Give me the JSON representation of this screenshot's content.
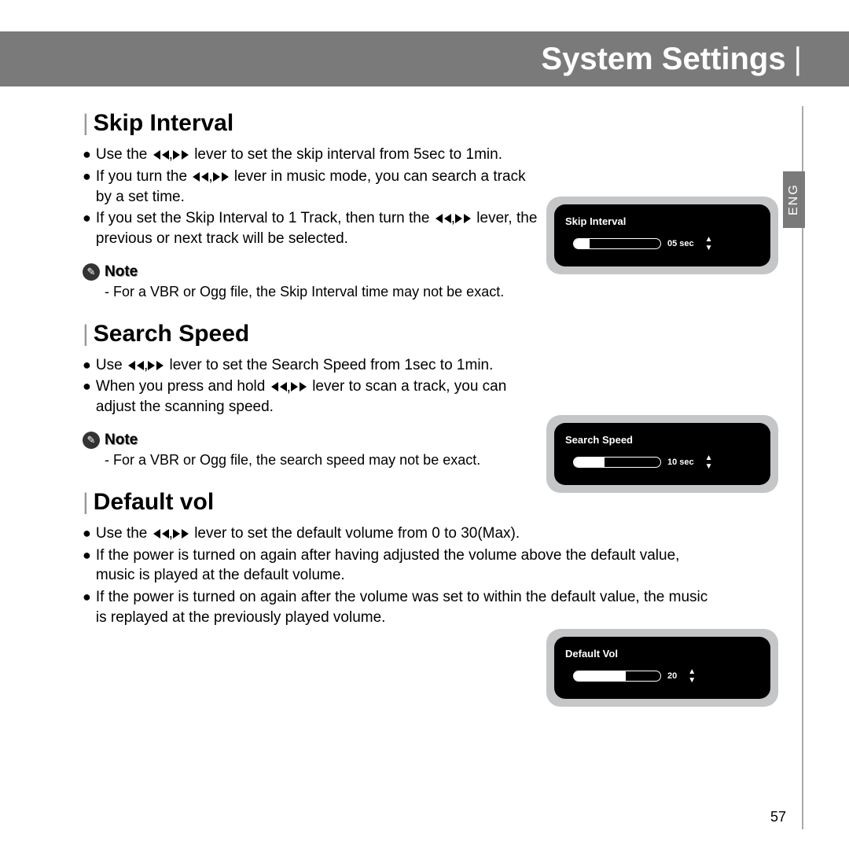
{
  "header": {
    "title": "System Settings"
  },
  "lang_tab": "ENG",
  "page_number": "57",
  "sections": {
    "skip": {
      "heading": "Skip Interval",
      "b1_a": "Use the ",
      "b1_b": " lever  to set the skip interval from 5sec to 1min.",
      "b2_a": "If you turn the ",
      "b2_b": " lever in music mode, you can search a track by a set time.",
      "b3_a": "If you set the Skip Interval to 1 Track, then turn the ",
      "b3_b": " lever, the previous or next track will be selected.",
      "note": "- For a VBR or Ogg file, the Skip Interval time may not be exact.",
      "device_title": "Skip Interval",
      "device_value": "05 sec",
      "device_fill_pct": 18
    },
    "search": {
      "heading": "Search Speed",
      "b1_a": "Use ",
      "b1_b": " lever  to set the Search Speed from 1sec to 1min.",
      "b2_a": "When you press and hold ",
      "b2_b": " lever to scan a track, you can adjust the scanning speed.",
      "note": "- For a VBR or Ogg file, the search speed may not be exact.",
      "device_title": "Search Speed",
      "device_value": "10 sec",
      "device_fill_pct": 35
    },
    "default_vol": {
      "heading": "Default vol",
      "b1_a": "Use the ",
      "b1_b": "  lever  to set the default volume from 0 to 30(Max).",
      "b2": "If the power is turned on again after having adjusted the volume above the default value, music is played at the default volume.",
      "b3": "If the power is turned on again after the volume was set to within the default value, the music is replayed at the previously played volume.",
      "device_title": "Default Vol",
      "device_value": "20",
      "device_fill_pct": 60
    }
  },
  "note_label": "Note"
}
